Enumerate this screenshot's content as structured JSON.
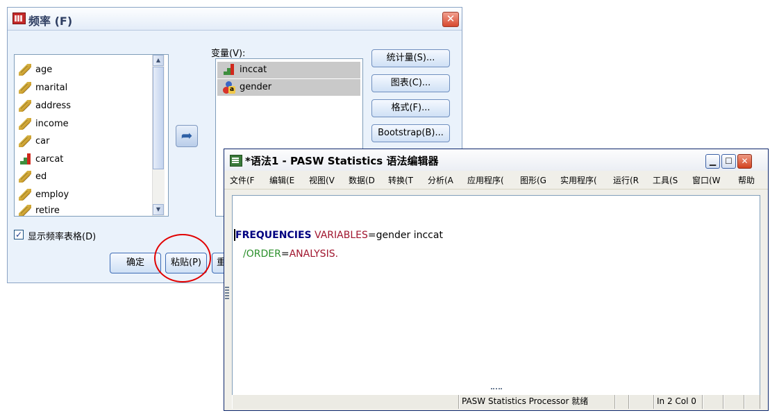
{
  "dialog": {
    "title": "频率 (F)",
    "source_variables": [
      {
        "label": "age",
        "icon": "ruler-icon"
      },
      {
        "label": "marital",
        "icon": "ruler-icon"
      },
      {
        "label": "address",
        "icon": "ruler-icon"
      },
      {
        "label": "income",
        "icon": "ruler-icon"
      },
      {
        "label": "car",
        "icon": "ruler-icon"
      },
      {
        "label": "carcat",
        "icon": "bar-chart-icon"
      },
      {
        "label": "ed",
        "icon": "ruler-icon"
      },
      {
        "label": "employ",
        "icon": "ruler-icon"
      },
      {
        "label": "retire",
        "icon": "ruler-icon"
      }
    ],
    "move_button_glyph": "➦",
    "variables_label": "变量(V):",
    "target_variables": [
      {
        "label": "inccat",
        "icon": "bar-chart-icon"
      },
      {
        "label": "gender",
        "icon": "nominal-person-icon"
      }
    ],
    "side_buttons": {
      "statistics": "统计量(S)...",
      "charts": "图表(C)...",
      "format": "格式(F)...",
      "bootstrap": "Bootstrap(B)..."
    },
    "show_tables_checkbox": {
      "label": "显示频率表格(D)",
      "checked": true
    },
    "bottom_buttons": {
      "ok": "确定",
      "paste": "粘贴(P)",
      "reset_partial": "重"
    },
    "highlight_color": "#e10000"
  },
  "editor": {
    "title": "*语法1 - PASW Statistics 语法编辑器",
    "menu": [
      "文件(F",
      "编辑(E",
      "视图(V",
      "数据(D",
      "转换(T",
      "分析(A",
      "应用程序(",
      "图形(G",
      "实用程序(",
      "运行(R",
      "工具(S",
      "窗口(W",
      "帮助"
    ],
    "code": {
      "line1_cmd": "FREQUENCIES",
      "line1_sub": "VARIABLES",
      "line1_eq": "=",
      "line1_val": "gender inccat",
      "line2_sub": "/ORDER",
      "line2_eq": "=",
      "line2_val": "ANALYSIS."
    },
    "status": {
      "processor": "PASW Statistics Processor 就绪",
      "position": "In 2 Col 0"
    },
    "colors": {
      "command": "#000080",
      "subcommand": "#a0142d",
      "order_subcommand": "#2a8f2a"
    }
  }
}
